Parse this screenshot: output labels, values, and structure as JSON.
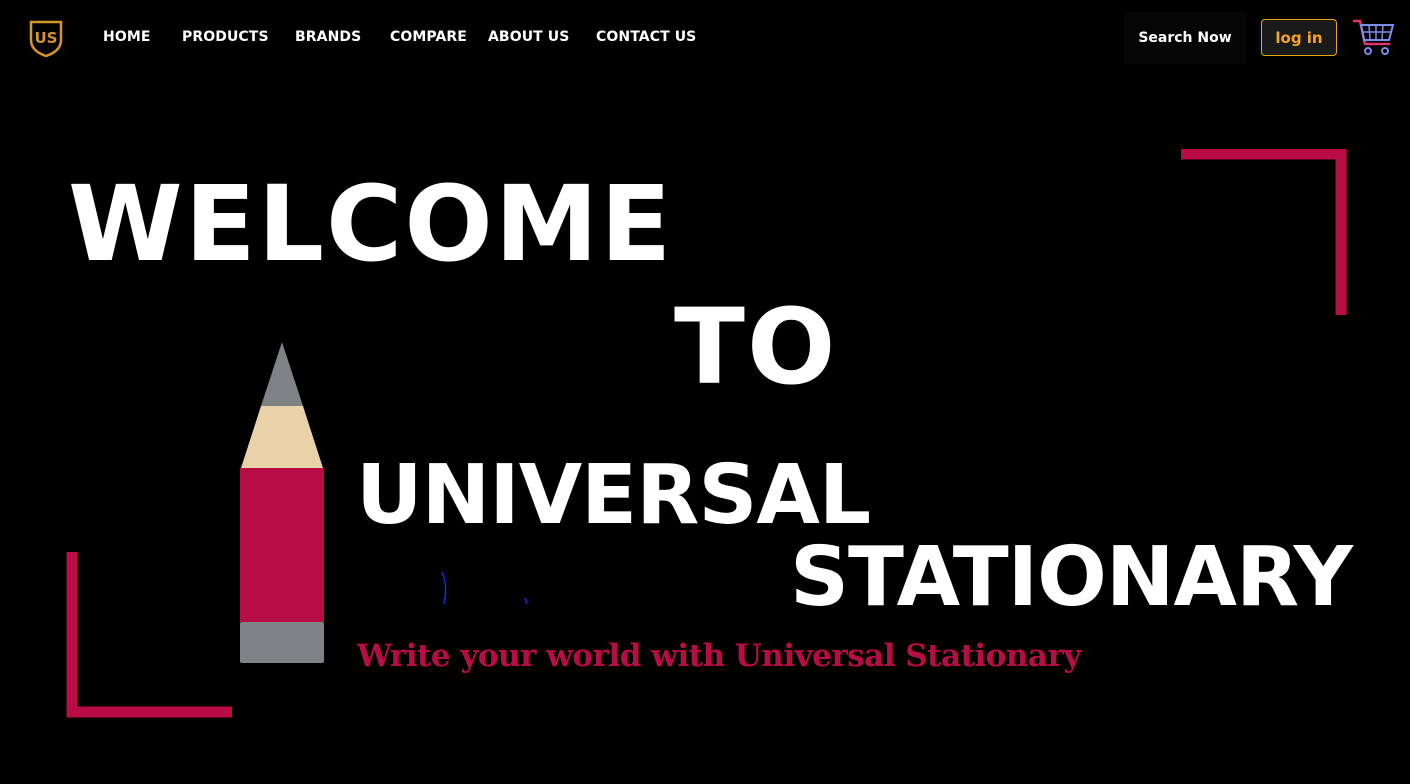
{
  "nav": {
    "logo_text": "US",
    "items": [
      "HOME",
      "PRODUCTS",
      "BRANDS",
      "COMPARE",
      "ABOUT US",
      "CONTACT US"
    ],
    "search_label": "Search Now",
    "login_label": "log in"
  },
  "hero": {
    "line1": "WELCOME",
    "line2": "TO",
    "line3": "UNIVERSAL",
    "line4": "STATIONARY",
    "tagline": "Write your world with Universal Stationary"
  },
  "colors": {
    "background": "#000000",
    "accent": "#b80c47",
    "gold": "#e8a317",
    "text": "#ffffff"
  },
  "icons": [
    "logo-shield-icon",
    "cart-icon",
    "pencil-illustration"
  ]
}
